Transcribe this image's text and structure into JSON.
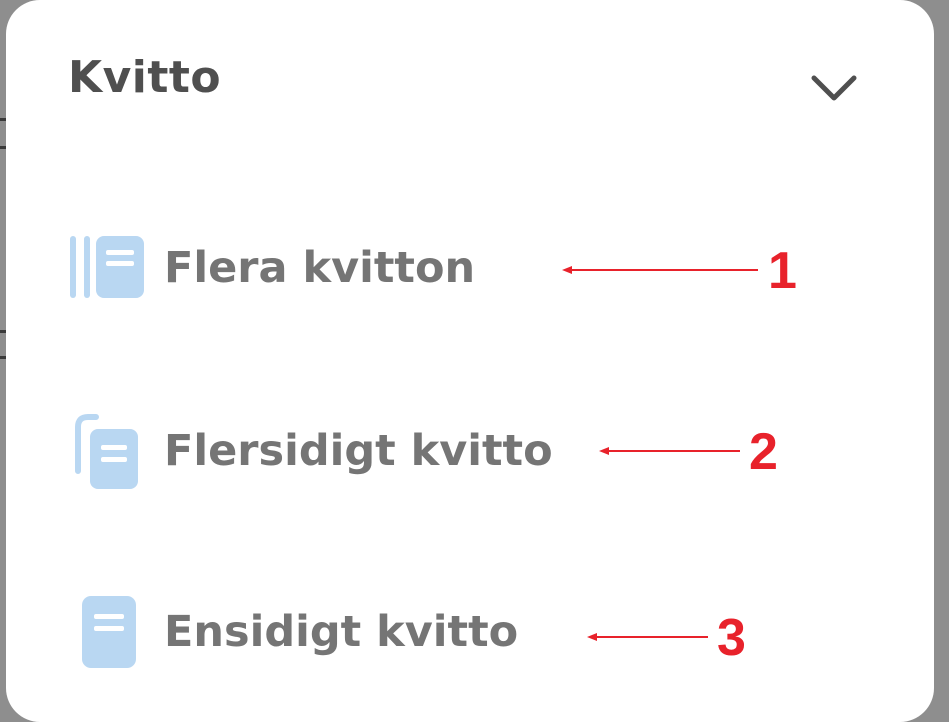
{
  "sheet": {
    "title": "Kvitto",
    "collapse_icon": "chevron-down-icon"
  },
  "options": [
    {
      "label": "Flera kvitton",
      "icon": "multiple-receipts-icon"
    },
    {
      "label": "Flersidigt kvitto",
      "icon": "multipage-receipt-icon"
    },
    {
      "label": "Ensidigt kvitto",
      "icon": "single-page-receipt-icon"
    }
  ],
  "annotations": [
    {
      "number": "1"
    },
    {
      "number": "2"
    },
    {
      "number": "3"
    }
  ],
  "colors": {
    "icon": "#b9d7f2",
    "icon_detail": "#ffffff",
    "label": "#757575",
    "title": "#4f4f4f",
    "annotation": "#e8222b",
    "backdrop": "#8e8e8e"
  }
}
